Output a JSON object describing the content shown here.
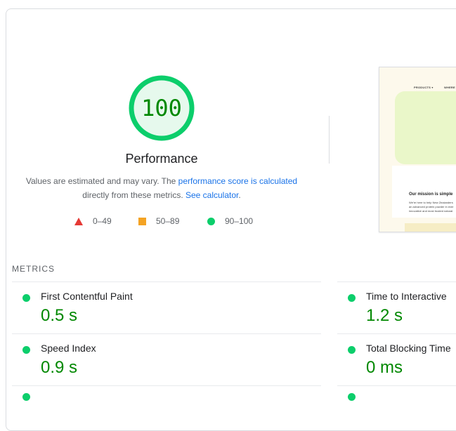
{
  "score": {
    "value": "100",
    "title": "Performance",
    "color": "#0cce6b",
    "fill": "#e6f9ed",
    "text_color": "#008800"
  },
  "description": {
    "text1": "Values are estimated and may vary. The ",
    "link1": "performance score is calculated",
    "text2": " directly from these metrics. ",
    "link2": "See calculator",
    "text3": "."
  },
  "legend": [
    {
      "label": "0–49",
      "shape": "triangle",
      "color": "#e53935"
    },
    {
      "label": "50–89",
      "shape": "square",
      "color": "#f4a324"
    },
    {
      "label": "90–100",
      "shape": "circle",
      "color": "#0cce6b"
    }
  ],
  "screenshot": {
    "nav": [
      "PRODUCTS ▾",
      "WHERE"
    ],
    "heading": "Our mission is simple",
    "lines": [
      "We're here to help New Zealanders",
      "an advanced protein powder in ever",
      "innovative and most trusted natural"
    ]
  },
  "metrics": {
    "title": "METRICS",
    "items": [
      {
        "label": "First Contentful Paint",
        "value": "0.5 s"
      },
      {
        "label": "Time to Interactive",
        "value": "1.2 s"
      },
      {
        "label": "Speed Index",
        "value": "0.9 s"
      },
      {
        "label": "Total Blocking Time",
        "value": "0 ms"
      }
    ]
  }
}
